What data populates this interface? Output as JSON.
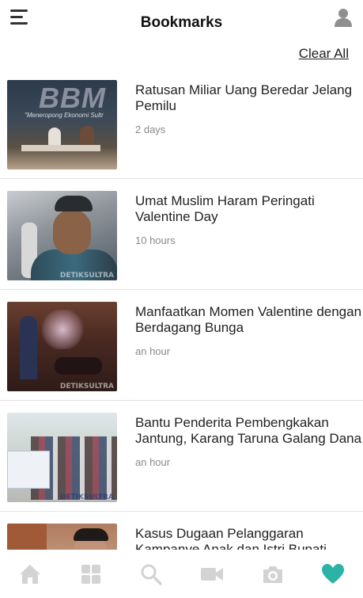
{
  "header": {
    "title": "Bookmarks",
    "clear_all_label": "Clear All"
  },
  "bookmarks": [
    {
      "title": "Ratusan Miliar Uang Beredar Jelang Pemilu",
      "time": "2 days",
      "thumb_text": "BBM",
      "thumb_sub": "\"Meneropong Ekonomi Sultr"
    },
    {
      "title": "Umat Muslim Haram Peringati Valentine Day",
      "time": "10 hours"
    },
    {
      "title": "Manfaatkan Momen Valentine dengan Berdagang Bunga",
      "time": "an hour"
    },
    {
      "title": "Bantu Penderita Pembengkakan Jantung, Karang Taruna Galang Dana",
      "time": "an hour"
    },
    {
      "title": "Kasus Dugaan Pelanggaran Kampanye Anak dan Istri Bupati",
      "time": ""
    }
  ],
  "watermark_text": "DETIKSULTRA",
  "tabs": [
    {
      "icon": "home-icon",
      "active": false
    },
    {
      "icon": "grid-icon",
      "active": false
    },
    {
      "icon": "search-icon",
      "active": false
    },
    {
      "icon": "video-icon",
      "active": false
    },
    {
      "icon": "camera-icon",
      "active": false
    },
    {
      "icon": "heart-icon",
      "active": true
    }
  ],
  "colors": {
    "tab_inactive": "#d3d3d3",
    "tab_active": "#2bb3a6",
    "divider": "#e2e2e2",
    "time_text": "#8a8a8a"
  }
}
